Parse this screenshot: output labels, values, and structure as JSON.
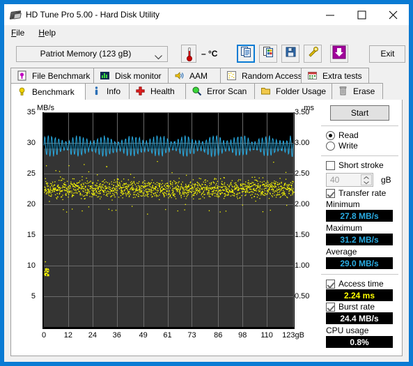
{
  "window": {
    "title": "HD Tune Pro 5.00 - Hard Disk Utility",
    "app_icon": "hard-disk-icon",
    "minimize": "—",
    "maximize": "□",
    "close": "✕"
  },
  "menu": {
    "items": [
      {
        "label": "File",
        "accel": "F",
        "rest": "ile"
      },
      {
        "label": "Help",
        "accel": "H",
        "rest": "elp"
      }
    ]
  },
  "toolbar": {
    "drive": "Patriot Memory   (123 gB)",
    "drive_arrow_icon": "chevron-down-icon",
    "temperature": "– °C",
    "thermometer_icon": "thermometer-icon",
    "buttons": [
      {
        "name": "copy-info-button",
        "icon": "copy-document-icon",
        "selected": true
      },
      {
        "name": "screenshot-button",
        "icon": "copy-image-icon",
        "selected": false
      },
      {
        "name": "save-button",
        "icon": "floppy-disk-icon",
        "selected": false
      },
      {
        "name": "settings-button",
        "icon": "wrench-icon",
        "selected": false
      },
      {
        "name": "download-button",
        "icon": "purple-down-arrow-icon",
        "selected": false
      }
    ],
    "exit_label": "Exit"
  },
  "tabs": {
    "row1": [
      {
        "label": "File Benchmark",
        "icon": "file-benchmark-icon",
        "active": false
      },
      {
        "label": "Disk monitor",
        "icon": "bar-chart-icon",
        "active": false
      },
      {
        "label": "AAM",
        "icon": "speaker-icon",
        "active": false
      },
      {
        "label": "Random Access",
        "icon": "random-access-icon",
        "active": false
      },
      {
        "label": "Extra tests",
        "icon": "extra-tests-icon",
        "active": false
      }
    ],
    "row2": [
      {
        "label": "Benchmark",
        "icon": "benchmark-bulb-icon",
        "active": true
      },
      {
        "label": "Info",
        "icon": "info-icon",
        "active": false
      },
      {
        "label": "Health",
        "icon": "health-cross-icon",
        "active": false
      },
      {
        "label": "Error Scan",
        "icon": "magnifier-icon",
        "active": false
      },
      {
        "label": "Folder Usage",
        "icon": "folder-icon",
        "active": false
      },
      {
        "label": "Erase",
        "icon": "trash-icon",
        "active": false
      }
    ]
  },
  "panel": {
    "start_label": "Start",
    "mode": {
      "read_label": "Read",
      "write_label": "Write",
      "read_selected": true,
      "write_selected": false
    },
    "short_stroke": {
      "label": "Short stroke",
      "checked": false,
      "value": "40",
      "unit": "gB",
      "spinner_icon": "spinner-arrows-icon"
    },
    "transfer_rate": {
      "label": "Transfer rate",
      "checked": true
    },
    "minimum": {
      "label": "Minimum",
      "value": "27.8 MB/s",
      "color": "#29abe2"
    },
    "maximum": {
      "label": "Maximum",
      "value": "31.2 MB/s",
      "color": "#29abe2"
    },
    "average": {
      "label": "Average",
      "value": "29.0 MB/s",
      "color": "#29abe2"
    },
    "access_time": {
      "label": "Access time",
      "checked": true,
      "value": "2.24 ms",
      "color": "#ffff00"
    },
    "burst_rate": {
      "label": "Burst rate",
      "checked": true,
      "value": "24.4 MB/s",
      "color": "#ffffff"
    },
    "cpu_usage": {
      "label": "CPU usage",
      "value": "0.8%",
      "color": "#ffffff"
    }
  },
  "chart_data": {
    "type": "line",
    "title": "",
    "xlabel": "",
    "ylabel": "MB/s",
    "y2label": "ms",
    "xlim": [
      0,
      123
    ],
    "ylim": [
      0,
      35
    ],
    "y2lim": [
      0,
      3.5
    ],
    "grid": true,
    "legend": null,
    "x_ticks": [
      0,
      12,
      24,
      36,
      49,
      61,
      73,
      86,
      98,
      110,
      123
    ],
    "x_tick_labels": [
      "0",
      "12",
      "24",
      "36",
      "49",
      "61",
      "73",
      "86",
      "98",
      "110",
      "123gB"
    ],
    "y_ticks": [
      5,
      10,
      15,
      20,
      25,
      30,
      35
    ],
    "y_tick_labels": [
      "5",
      "10",
      "15",
      "20",
      "25",
      "30",
      "35"
    ],
    "y2_ticks": [
      0.5,
      1.0,
      1.5,
      2.0,
      2.5,
      3.0,
      3.5
    ],
    "y2_tick_labels": [
      "0.50",
      "1.00",
      "1.50",
      "2.00",
      "2.50",
      "3.00",
      "3.50"
    ],
    "series": [
      {
        "name": "Transfer rate",
        "type": "line",
        "color": "#29abe2",
        "axis": "left",
        "units": "MB/s",
        "min": 27.8,
        "max": 31.2,
        "average": 29.0,
        "description": "Dense sawtooth oscillation across the whole 0-123 gB span, cycling roughly between 27.8 and 31.2 MB/s"
      },
      {
        "name": "Access time",
        "type": "scatter",
        "color": "#ffff00",
        "axis": "right",
        "units": "ms",
        "average": 2.24,
        "cluster_center_ms": 2.26,
        "cluster_spread_ms": 0.18,
        "outlier_cluster_ms": 0.9,
        "description": "Dense yellow scatter band centred near 2.26 ms over the full span, plus a tight low cluster near 0.9 ms at the very start"
      }
    ]
  }
}
